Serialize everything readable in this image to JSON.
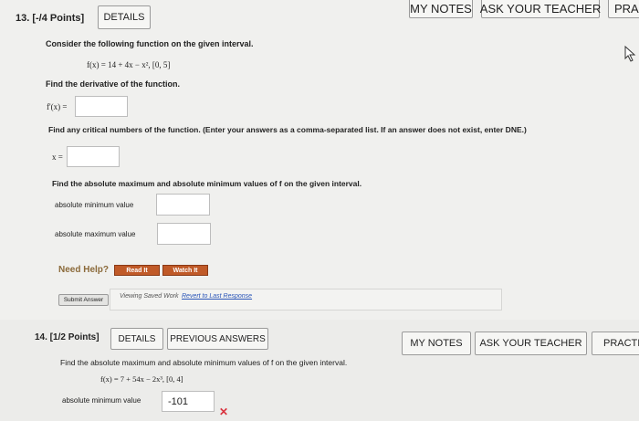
{
  "question13": {
    "number_points": "13. [-/4 Points]",
    "details_label": "DETAILS",
    "my_notes_label": "MY NOTES",
    "ask_teacher_label": "ASK YOUR TEACHER",
    "practice_label": "PRAC",
    "intro": "Consider the following function on the given interval.",
    "function": "f(x) = 14 + 4x − x²,   [0, 5]",
    "derivative_prompt": "Find the derivative of the function.",
    "derivative_label": "f'(x) =",
    "derivative_value": "",
    "critical_prompt": "Find any critical numbers of the function. (Enter your answers as a comma-separated list. If an answer does not exist, enter DNE.)",
    "critical_label": "x =",
    "critical_value": "",
    "extrema_prompt": "Find the absolute maximum and absolute minimum values of f on the given interval.",
    "abs_min_label": "absolute minimum value",
    "abs_min_value": "",
    "abs_max_label": "absolute maximum value",
    "abs_max_value": "",
    "need_help": "Need Help?",
    "read_it": "Read It",
    "watch_it": "Watch It",
    "submit_answer": "Submit Answer",
    "viewing_saved": "Viewing Saved Work",
    "revert_link": "Revert to Last Response"
  },
  "question14": {
    "number_points": "14. [1/2 Points]",
    "details_label": "DETAILS",
    "previous_answers_label": "PREVIOUS ANSWERS",
    "my_notes_label": "MY NOTES",
    "ask_teacher_label": "ASK YOUR TEACHER",
    "practice_label": "PRACTIC",
    "prompt": "Find the absolute maximum and absolute minimum values of f on the given interval.",
    "function": "f(x) = 7 + 54x − 2x³,   [0, 4]",
    "abs_min_label": "absolute minimum value",
    "abs_min_value": "-101",
    "incorrect_mark": "✕"
  },
  "colors": {
    "help_orange": "#c05a28",
    "need_help_text": "#8b6a3a",
    "incorrect_red": "#d9333f",
    "link_blue": "#2a55b8"
  }
}
